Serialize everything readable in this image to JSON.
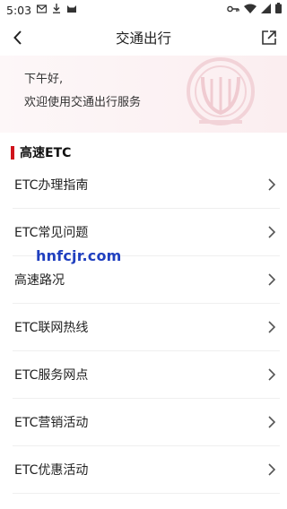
{
  "status_bar": {
    "time": "5:03"
  },
  "nav": {
    "title": "交通出行"
  },
  "banner": {
    "greeting": "下午好,",
    "welcome": "欢迎使用交通出行服务"
  },
  "section": {
    "title": "高速ETC"
  },
  "menu": [
    {
      "label": "ETC办理指南"
    },
    {
      "label": "ETC常见问题"
    },
    {
      "label": "高速路况"
    },
    {
      "label": "ETC联网热线"
    },
    {
      "label": "ETC服务网点"
    },
    {
      "label": "ETC营销活动"
    },
    {
      "label": "ETC优惠活动"
    }
  ],
  "watermark": {
    "text": "hnfcjr.com"
  },
  "colors": {
    "accent": "#d0141c",
    "banner_bg": "#fbeef0",
    "watermark": "#1f3fbf"
  }
}
